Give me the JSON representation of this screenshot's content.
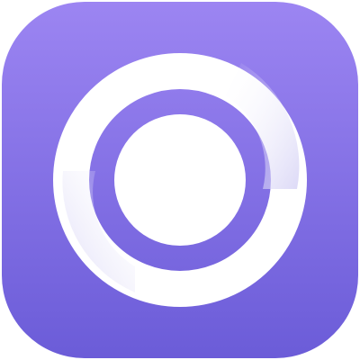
{
  "app_icon": {
    "icon": "ring-logo-icon",
    "colors": {
      "background_top": "#9C85F2",
      "background_bottom": "#6B5CD8",
      "ring": "#FFFFFF",
      "ring_shadow": "#D2CEF4",
      "center_dot": "#FFFFFF"
    }
  }
}
